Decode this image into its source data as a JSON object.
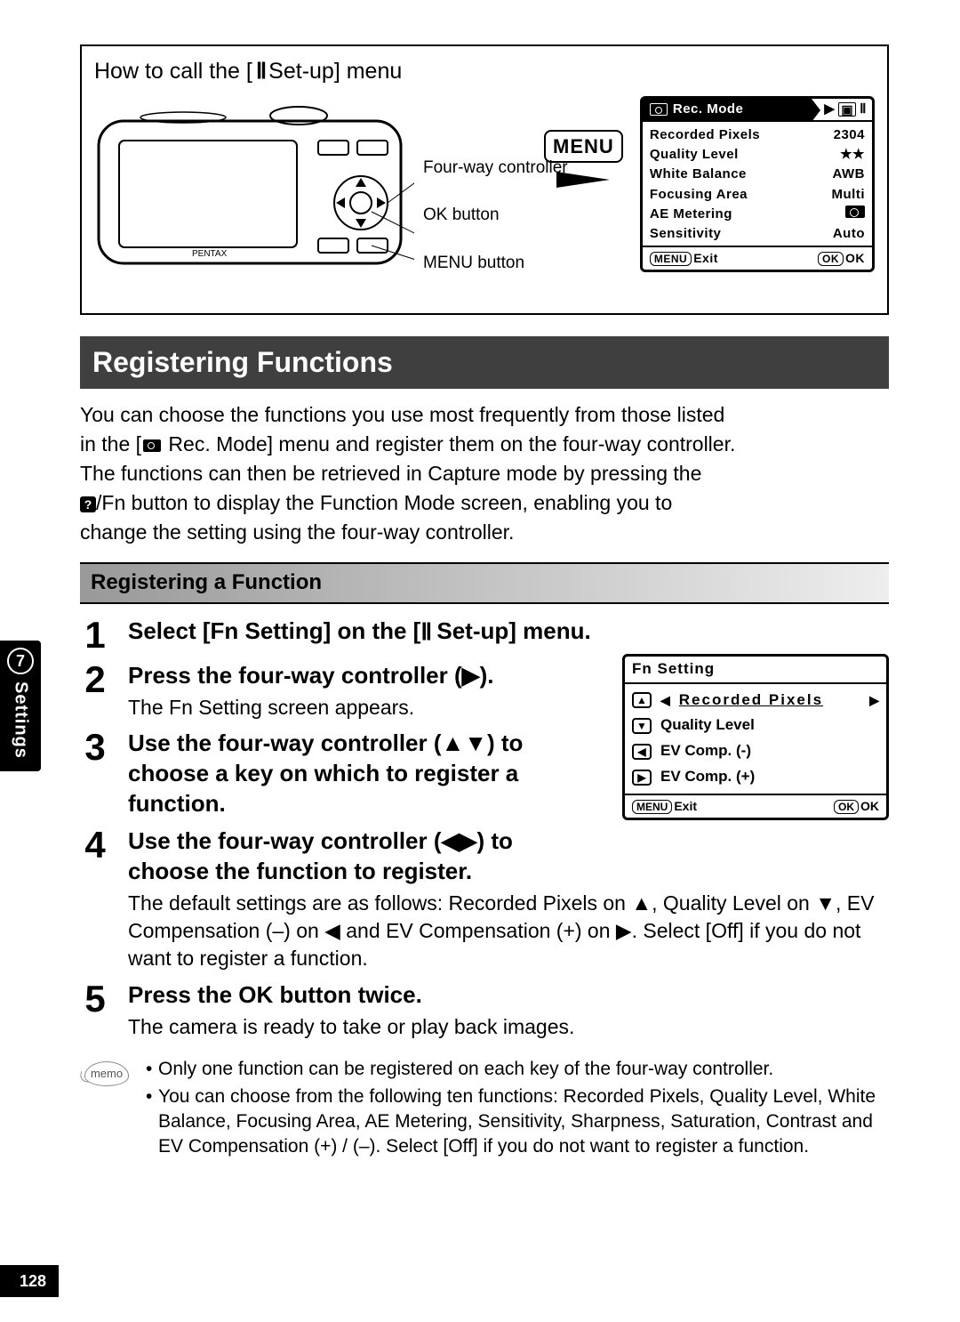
{
  "howto_prefix": "How to call the [",
  "howto_suffix": " Set-up] menu",
  "setup_icon_text": "Ⅱ",
  "diagram": {
    "label_fourway": "Four-way controller",
    "label_ok": "OK button",
    "label_menu": "MENU button",
    "menu_button_label": "MENU"
  },
  "rec_mode_screen": {
    "title": "Rec. Mode",
    "rows": [
      {
        "label": "Recorded Pixels",
        "value": "2304"
      },
      {
        "label": "Quality Level",
        "value": "★★"
      },
      {
        "label": "White Balance",
        "value": "AWB"
      },
      {
        "label": "Focusing Area",
        "value": "Multi"
      },
      {
        "label": "AE Metering",
        "value": "__METERING_ICON__"
      },
      {
        "label": "Sensitivity",
        "value": "Auto"
      }
    ],
    "footer_left_btn": "MENU",
    "footer_left": "Exit",
    "footer_right_btn": "OK",
    "footer_right": "OK"
  },
  "section_title": "Registering Functions",
  "intro_lines": [
    "You can choose the functions you use most frequently from those listed",
    "in the [__CAM__ Rec. Mode] menu and register them on the four-way controller.",
    "The functions can then be retrieved in Capture mode by pressing the",
    "__Q__/Fn button to display the Function Mode screen, enabling you to",
    "change the setting using the four-way controller."
  ],
  "sub_bar": "Registering a Function",
  "steps": {
    "s1_title_a": "Select [Fn Setting] on the [",
    "s1_title_b": " Set-up] menu.",
    "s2_title": "Press the four-way controller (▶).",
    "s2_desc": "The Fn Setting screen appears.",
    "s3_title": "Use the four-way controller (▲▼) to choose a key on which to register a function.",
    "s4_title": "Use the four-way controller (◀▶) to choose the function to register.",
    "s4_desc": "The default settings are as follows: Recorded Pixels on ▲, Quality Level on ▼, EV Compensation (–) on ◀ and EV Compensation (+) on ▶. Select [Off] if you do not want to register a function.",
    "s5_title": "Press the OK button twice.",
    "s5_desc": "The camera is ready to take or play back images."
  },
  "fn_screen": {
    "title": "Fn Setting",
    "rows": [
      {
        "key": "▲",
        "label": "Recorded Pixels",
        "selected": true
      },
      {
        "key": "▼",
        "label": "Quality Level"
      },
      {
        "key": "◀",
        "label": "EV Comp. (-)"
      },
      {
        "key": "▶",
        "label": "EV Comp. (+)"
      }
    ],
    "footer_left_btn": "MENU",
    "footer_left": "Exit",
    "footer_right_btn": "OK",
    "footer_right": "OK"
  },
  "memo": [
    "Only one function can be registered on each key of the four-way controller.",
    "You can choose from the following ten functions: Recorded Pixels, Quality Level, White Balance, Focusing Area, AE Metering, Sensitivity, Sharpness, Saturation, Contrast and EV Compensation (+) / (–). Select [Off] if you do not want to register a function."
  ],
  "memo_label": "memo",
  "side": {
    "num": "7",
    "label": "Settings"
  },
  "page_number": "128"
}
